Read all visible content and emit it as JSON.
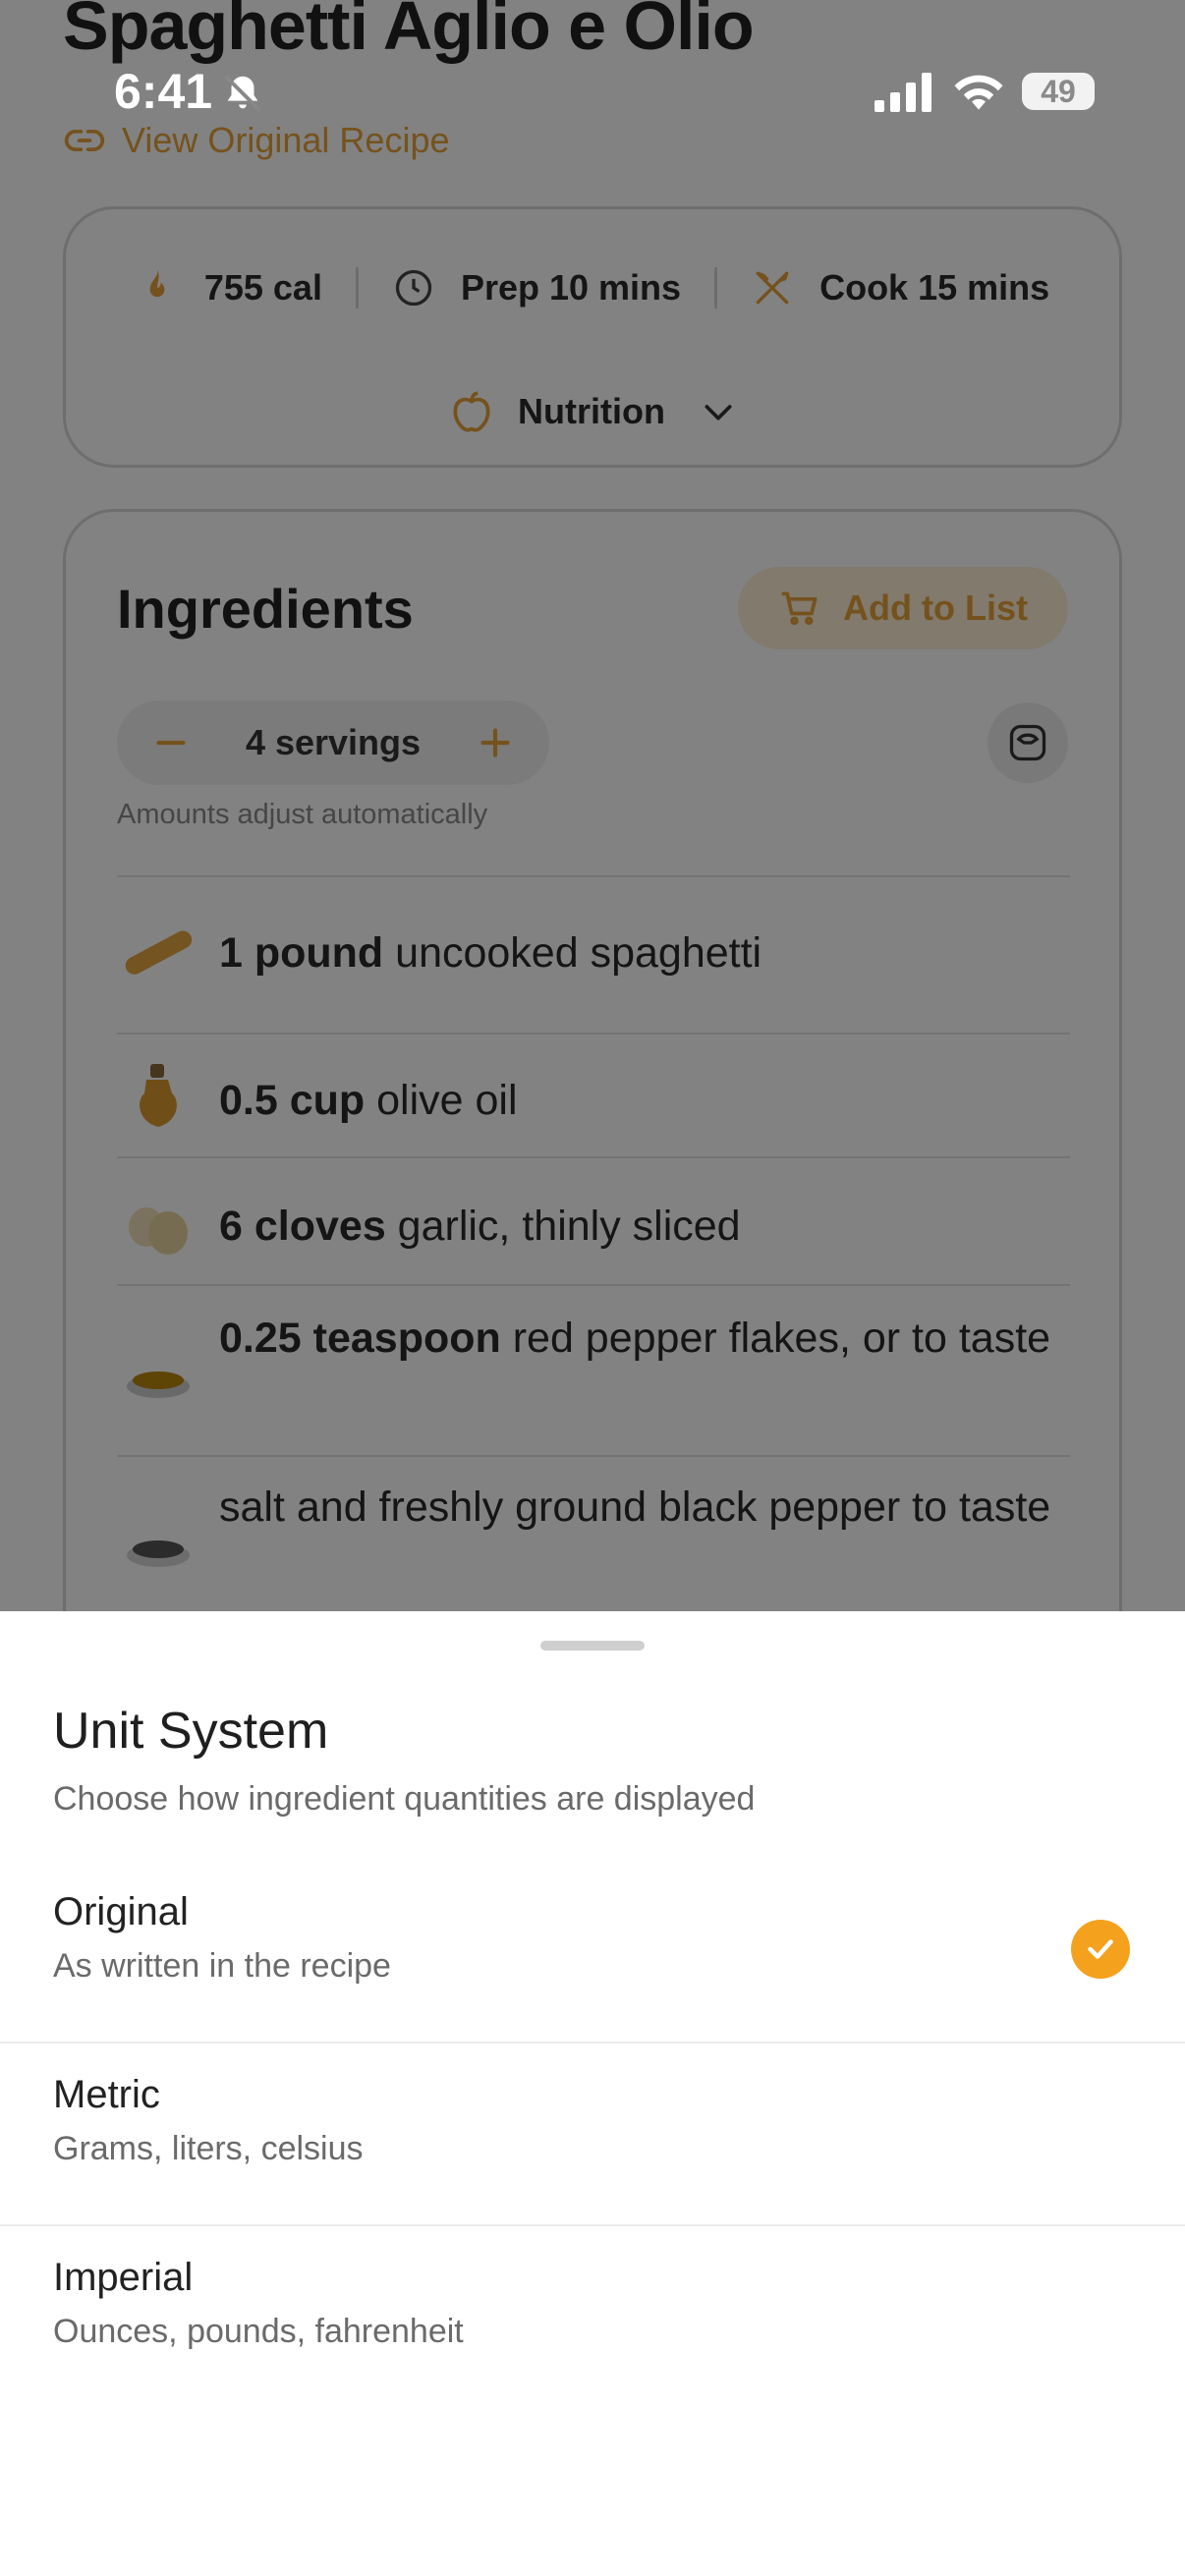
{
  "recipe": {
    "title": "Spaghetti Aglio e Olio",
    "view_original_label": "View Original Recipe"
  },
  "status_bar": {
    "time": "6:41",
    "battery": "49"
  },
  "stats": {
    "calories": "755 cal",
    "prep": "Prep 10 mins",
    "cook": "Cook 15 mins",
    "nutrition_label": "Nutrition"
  },
  "ingredients": {
    "title": "Ingredients",
    "add_to_list_label": "Add to List",
    "servings_label": "4 servings",
    "auto_note": "Amounts adjust automatically",
    "items": [
      {
        "qty": "1 pound",
        "text": " uncooked spaghetti",
        "icon": "spaghetti-icon"
      },
      {
        "qty": "0.5 cup",
        "text": " olive oil",
        "icon": "olive-oil-icon"
      },
      {
        "qty": "6 cloves",
        "text": " garlic, thinly sliced",
        "icon": "garlic-icon"
      },
      {
        "qty": "0.25 teaspoon",
        "text": " red pepper flakes, or to taste",
        "icon": "pepper-flakes-icon"
      },
      {
        "qty": "",
        "text": "salt and freshly ground black pepper to taste",
        "icon": "salt-pepper-icon"
      }
    ]
  },
  "unit_sheet": {
    "title": "Unit System",
    "subtitle": "Choose how ingredient quantities are displayed",
    "options": [
      {
        "label": "Original",
        "desc": "As written in the recipe",
        "selected": true
      },
      {
        "label": "Metric",
        "desc": "Grams, liters, celsius",
        "selected": false
      },
      {
        "label": "Imperial",
        "desc": "Ounces, pounds, fahrenheit",
        "selected": false
      }
    ]
  },
  "colors": {
    "accent": "#f4a11e",
    "overlay": "rgba(0,0,0,0.49)"
  }
}
